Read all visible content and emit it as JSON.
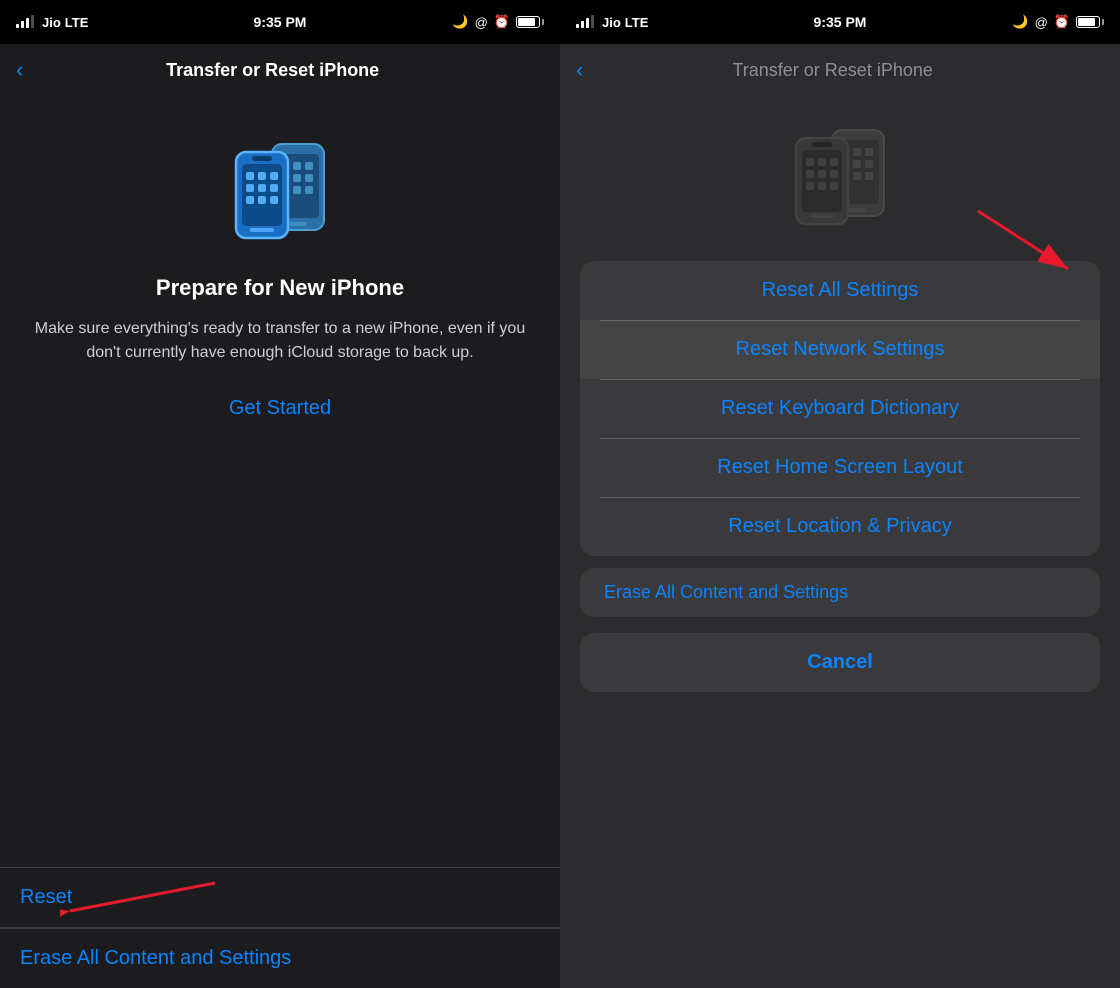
{
  "left": {
    "statusBar": {
      "carrier": "Jio",
      "network": "LTE",
      "time": "9:35 PM",
      "battery": "90%"
    },
    "navTitle": "Transfer or Reset iPhone",
    "phoneIcon": "phone-transfer-icon",
    "prepareTitle": "Prepare for New iPhone",
    "prepareDesc": "Make sure everything's ready to transfer to a new iPhone, even if you don't currently have enough iCloud storage to back up.",
    "getStarted": "Get Started",
    "resetLabel": "Reset",
    "eraseLabel": "Erase All Content and Settings"
  },
  "right": {
    "statusBar": {
      "carrier": "Jio",
      "network": "LTE",
      "time": "9:35 PM",
      "battery": "90%"
    },
    "navTitle": "Transfer or Reset iPhone",
    "menuItems": [
      {
        "label": "Reset All Settings"
      },
      {
        "label": "Reset Network Settings",
        "highlighted": true
      },
      {
        "label": "Reset Keyboard Dictionary"
      },
      {
        "label": "Reset Home Screen Layout"
      },
      {
        "label": "Reset Location & Privacy"
      }
    ],
    "eraseLabel": "Erase All Content and Settings",
    "cancelLabel": "Cancel"
  }
}
